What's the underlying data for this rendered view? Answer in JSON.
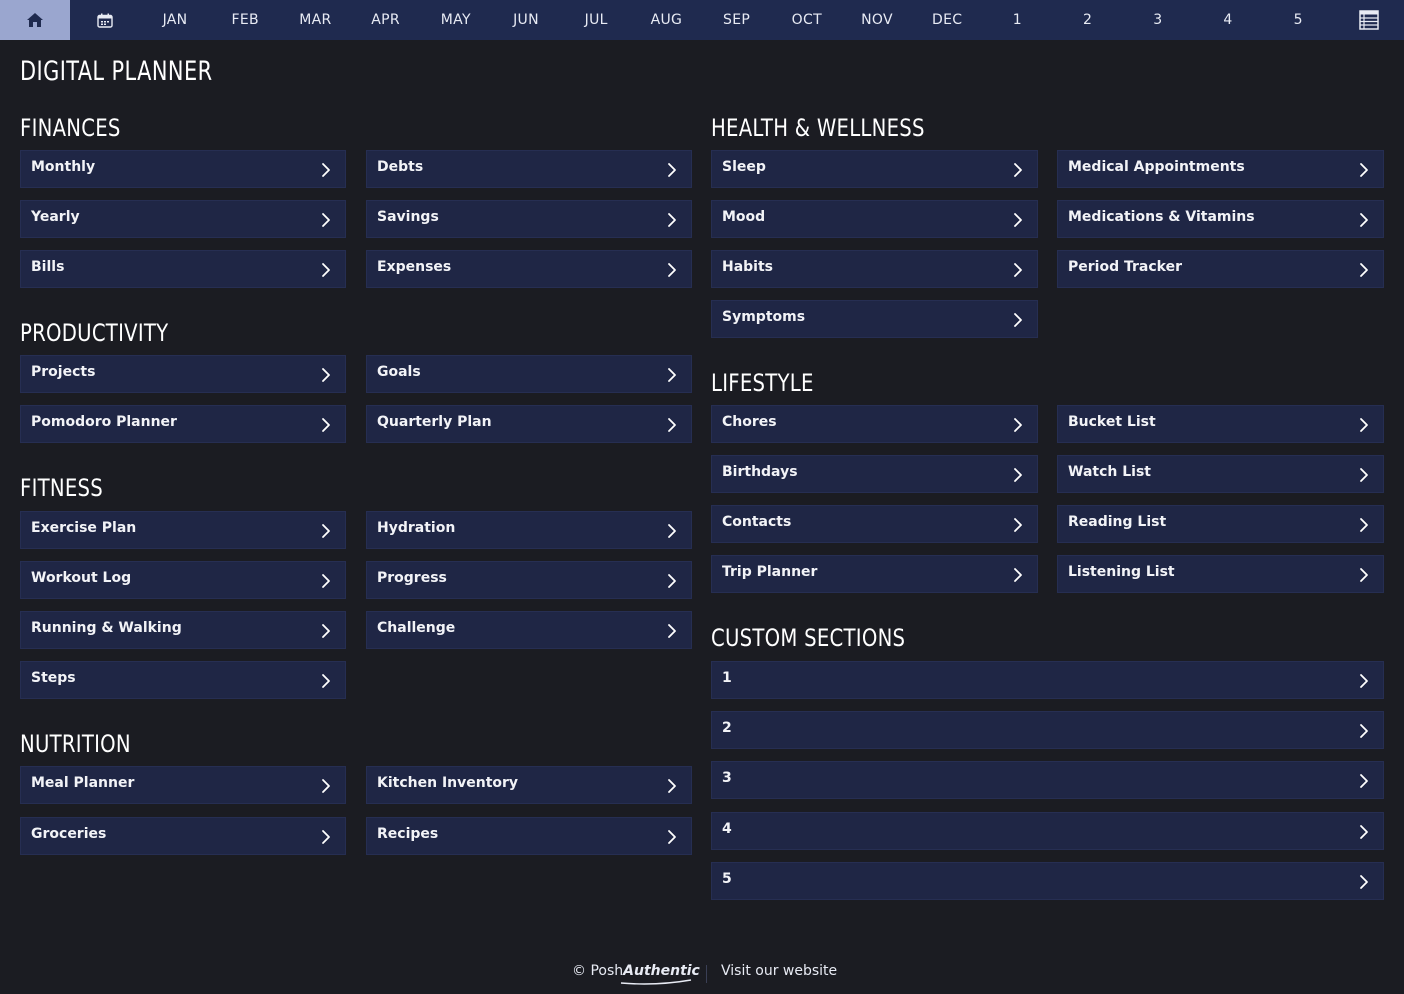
{
  "nav": {
    "home_icon": "home-icon",
    "calendar_icon": "calendar-icon",
    "months": [
      "JAN",
      "FEB",
      "MAR",
      "APR",
      "MAY",
      "JUN",
      "JUL",
      "AUG",
      "SEP",
      "OCT",
      "NOV",
      "DEC"
    ],
    "numbers": [
      "1",
      "2",
      "3",
      "4",
      "5"
    ],
    "list_icon": "table-list-icon"
  },
  "page_title": "DIGITAL PLANNER",
  "sections": {
    "finances": {
      "title": "FINANCES",
      "items": [
        "Monthly",
        "Debts",
        "Yearly",
        "Savings",
        "Bills",
        "Expenses"
      ]
    },
    "productivity": {
      "title": "PRODUCTIVITY",
      "items": [
        "Projects",
        "Goals",
        "Pomodoro Planner",
        "Quarterly Plan"
      ]
    },
    "fitness": {
      "title": "FITNESS",
      "items": [
        "Exercise Plan",
        "Hydration",
        "Workout Log",
        "Progress",
        "Running & Walking",
        "Challenge",
        "Steps"
      ]
    },
    "nutrition": {
      "title": "NUTRITION",
      "items": [
        "Meal Planner",
        "Kitchen Inventory",
        "Groceries",
        "Recipes"
      ]
    },
    "health": {
      "title": "HEALTH & WELLNESS",
      "items": [
        "Sleep",
        "Medical Appointments",
        "Mood",
        "Medications & Vitamins",
        "Habits",
        "Period Tracker",
        "Symptoms"
      ]
    },
    "lifestyle": {
      "title": "LIFESTYLE",
      "items": [
        "Chores",
        "Bucket List",
        "Birthdays",
        "Watch List",
        "Contacts",
        "Reading List",
        "Trip Planner",
        "Listening List"
      ]
    },
    "custom": {
      "title": "CUSTOM SECTIONS",
      "items": [
        "1",
        "2",
        "3",
        "4",
        "5"
      ]
    }
  },
  "footer": {
    "copyright_symbol": "©",
    "brand_light": "Posh",
    "brand_bold": "Authentic",
    "link": "Visit our website"
  },
  "colors": {
    "background": "#1b1c22",
    "nav_bar": "#1f2a4f",
    "nav_active": "#9aa6cf",
    "tile": "#1f2645"
  }
}
